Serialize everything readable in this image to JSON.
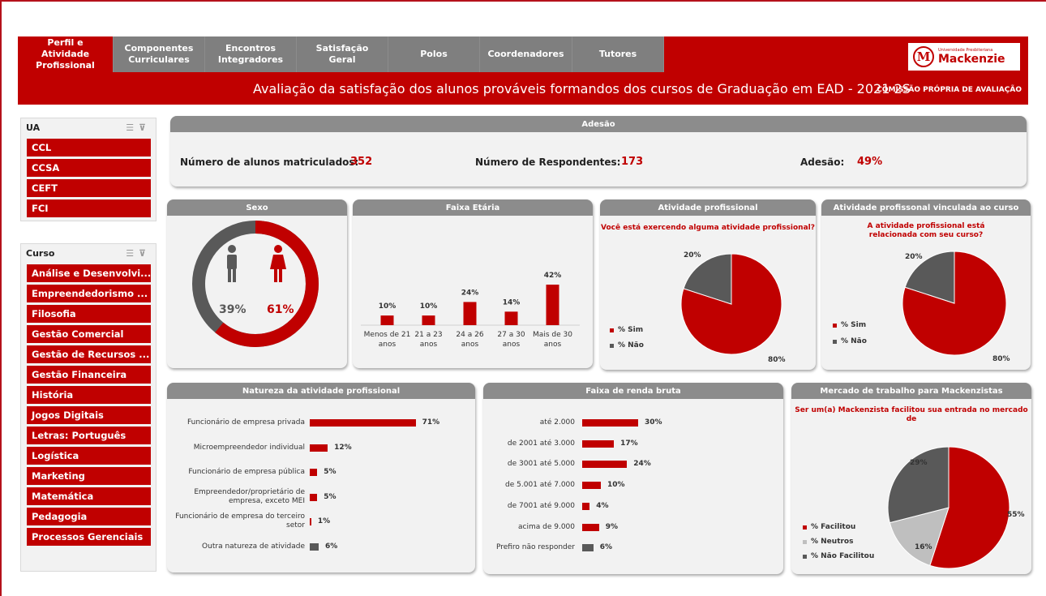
{
  "colors": {
    "brand_red": "#c00000",
    "dark_gray": "#595959",
    "light_gray": "#bfbfbf",
    "panel_bg": "#f2f2f2",
    "header_gray": "#8c8c8c"
  },
  "tabs": [
    {
      "label": "Perfil e Atividade Profissional",
      "active": true
    },
    {
      "label": "Componentes Curriculares",
      "active": false
    },
    {
      "label": "Encontros Integradores",
      "active": false
    },
    {
      "label": "Satisfação Geral",
      "active": false
    },
    {
      "label": "Polos",
      "active": false
    },
    {
      "label": "Coordenadores",
      "active": false
    },
    {
      "label": "Tutores",
      "active": false
    }
  ],
  "logo": {
    "small": "Universidade Presbiteriana",
    "big": "Mackenzie",
    "icon": "mackenzie-m-logo"
  },
  "header": {
    "title": "Avaliação da satisfação dos alunos prováveis formandos dos cursos de Graduação em EAD - 2021 2S",
    "subtitle": "COMISSÃO PRÓPRIA DE AVALIAÇÃO"
  },
  "slicers": {
    "ua": {
      "title": "UA",
      "items": [
        "CCL",
        "CCSA",
        "CEFT",
        "FCI"
      ]
    },
    "curso": {
      "title": "Curso",
      "items": [
        "Análise e Desenvolvi...",
        "Empreendedorismo ...",
        "Filosofia",
        "Gestão Comercial",
        "Gestão de Recursos ...",
        "Gestão Financeira",
        "História",
        "Jogos Digitais",
        "Letras: Português",
        "Logística",
        "Marketing",
        "Matemática",
        "Pedagogia",
        "Processos Gerenciais"
      ]
    }
  },
  "adesao": {
    "title": "Adesão",
    "matriculados_label": "Número de alunos matriculados:",
    "matriculados_value": "352",
    "respondentes_label": "Número de Respondentes:",
    "respondentes_value": "173",
    "adesao_label": "Adesão:",
    "adesao_value": "49%"
  },
  "sexo": {
    "title": "Sexo",
    "male_label": "39%",
    "female_label": "61%",
    "male_pct": 39,
    "female_pct": 61
  },
  "faixa_etaria": {
    "title": "Faixa Etária"
  },
  "atividade": {
    "title": "Atividade profissional",
    "question": "Você está exercendo alguma atividade profissional?",
    "legend": [
      "% Sim",
      "% Não"
    ],
    "labels": [
      "80%",
      "20%"
    ]
  },
  "atividade_vinculada": {
    "title": "Atividade profissonal vinculada ao curso",
    "question": "A atividade profissional está relacionada com seu curso?",
    "legend": [
      "% Sim",
      "% Não"
    ],
    "labels": [
      "80%",
      "20%"
    ]
  },
  "natureza": {
    "title": "Natureza da atividade profissional"
  },
  "renda": {
    "title": "Faixa de renda bruta"
  },
  "mercado": {
    "title": "Mercado de trabalho para Mackenzistas",
    "question": "Ser um(a) Mackenzista facilitou sua entrada no mercado de",
    "legend": [
      "% Facilitou",
      "% Neutros",
      "% Não Facilitou"
    ],
    "labels": [
      "55%",
      "16%",
      "29%"
    ]
  },
  "chart_data": [
    {
      "type": "bar",
      "title": "Faixa Etária",
      "categories": [
        "Menos de 21 anos",
        "21 a 23 anos",
        "24 a 26 anos",
        "27 a 30 anos",
        "Mais de 30 anos"
      ],
      "values": [
        10,
        10,
        24,
        14,
        42
      ],
      "labels": [
        "10%",
        "10%",
        "24%",
        "14%",
        "42%"
      ]
    },
    {
      "type": "pie",
      "title": "Atividade profissional",
      "categories": [
        "% Sim",
        "% Não"
      ],
      "values": [
        80,
        20
      ]
    },
    {
      "type": "pie",
      "title": "Atividade profissonal vinculada ao curso",
      "categories": [
        "% Sim",
        "% Não"
      ],
      "values": [
        80,
        20
      ]
    },
    {
      "type": "bar",
      "title": "Natureza da atividade profissional",
      "categories": [
        "Funcionário de empresa privada",
        "Microempreendedor individual",
        "Funcionário de empresa pública",
        "Empreendedor/proprietário de empresa, exceto MEI",
        "Funcionário de empresa do terceiro setor",
        "Outra natureza de atividade"
      ],
      "values": [
        71,
        12,
        5,
        5,
        1,
        6
      ],
      "labels": [
        "71%",
        "12%",
        "5%",
        "5%",
        "1%",
        "6%"
      ]
    },
    {
      "type": "bar",
      "title": "Faixa de renda bruta",
      "categories": [
        "até 2.000",
        "de 2001 até 3.000",
        "de 3001 até 5.000",
        "de 5.001 até 7.000",
        "de 7001 até 9.000",
        "acima de 9.000",
        "Prefiro não responder"
      ],
      "values": [
        30,
        17,
        24,
        10,
        4,
        9,
        6
      ],
      "labels": [
        "30%",
        "17%",
        "24%",
        "10%",
        "4%",
        "9%",
        "6%"
      ]
    },
    {
      "type": "pie",
      "title": "Mercado de trabalho para Mackenzistas",
      "categories": [
        "% Facilitou",
        "% Neutros",
        "% Não Facilitou"
      ],
      "values": [
        55,
        16,
        29
      ]
    }
  ]
}
